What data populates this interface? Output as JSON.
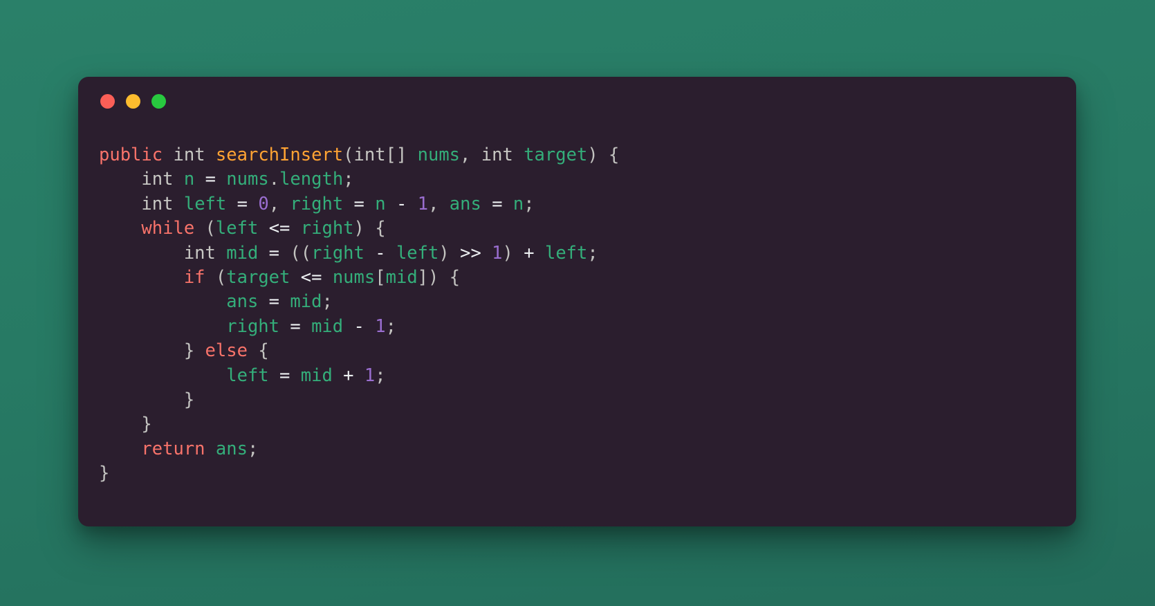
{
  "window": {
    "traffic_lights": [
      {
        "name": "close",
        "color": "#fc5f57"
      },
      {
        "name": "minimize",
        "color": "#fdbc2e"
      },
      {
        "name": "maximize",
        "color": "#28c93f"
      }
    ]
  },
  "theme": {
    "backdrop": "#277a64",
    "card_background": "#2b1e2e",
    "keyword": "#f8736a",
    "type": "#c8c8c4",
    "function": "#ffa333",
    "identifier": "#34ae7a",
    "number": "#9a6ed0",
    "operator": "#eceff1",
    "punctuation": "#c3c3c0"
  },
  "code": {
    "language": "java",
    "full_text": "public int searchInsert(int[] nums, int target) {\n    int n = nums.length;\n    int left = 0, right = n - 1, ans = n;\n    while (left <= right) {\n        int mid = ((right - left) >> 1) + left;\n        if (target <= nums[mid]) {\n            ans = mid;\n            right = mid - 1;\n        } else {\n            left = mid + 1;\n        }\n    }\n    return ans;\n}",
    "lines": [
      {
        "indent": 0,
        "tokens": [
          {
            "t": "public",
            "k": "keyword"
          },
          {
            "t": " ",
            "k": "plain"
          },
          {
            "t": "int",
            "k": "type"
          },
          {
            "t": " ",
            "k": "plain"
          },
          {
            "t": "searchInsert",
            "k": "func"
          },
          {
            "t": "(",
            "k": "punct"
          },
          {
            "t": "int[]",
            "k": "type"
          },
          {
            "t": " ",
            "k": "plain"
          },
          {
            "t": "nums",
            "k": "ident"
          },
          {
            "t": ",",
            "k": "punct"
          },
          {
            "t": " ",
            "k": "plain"
          },
          {
            "t": "int",
            "k": "type"
          },
          {
            "t": " ",
            "k": "plain"
          },
          {
            "t": "target",
            "k": "ident"
          },
          {
            "t": ")",
            "k": "punct"
          },
          {
            "t": " ",
            "k": "plain"
          },
          {
            "t": "{",
            "k": "punct"
          }
        ]
      },
      {
        "indent": 1,
        "tokens": [
          {
            "t": "int",
            "k": "type"
          },
          {
            "t": " ",
            "k": "plain"
          },
          {
            "t": "n",
            "k": "ident"
          },
          {
            "t": " ",
            "k": "plain"
          },
          {
            "t": "=",
            "k": "operator"
          },
          {
            "t": " ",
            "k": "plain"
          },
          {
            "t": "nums",
            "k": "ident"
          },
          {
            "t": ".",
            "k": "punct"
          },
          {
            "t": "length",
            "k": "ident"
          },
          {
            "t": ";",
            "k": "punct"
          }
        ]
      },
      {
        "indent": 1,
        "tokens": [
          {
            "t": "int",
            "k": "type"
          },
          {
            "t": " ",
            "k": "plain"
          },
          {
            "t": "left",
            "k": "ident"
          },
          {
            "t": " ",
            "k": "plain"
          },
          {
            "t": "=",
            "k": "operator"
          },
          {
            "t": " ",
            "k": "plain"
          },
          {
            "t": "0",
            "k": "number"
          },
          {
            "t": ",",
            "k": "punct"
          },
          {
            "t": " ",
            "k": "plain"
          },
          {
            "t": "right",
            "k": "ident"
          },
          {
            "t": " ",
            "k": "plain"
          },
          {
            "t": "=",
            "k": "operator"
          },
          {
            "t": " ",
            "k": "plain"
          },
          {
            "t": "n",
            "k": "ident"
          },
          {
            "t": " ",
            "k": "plain"
          },
          {
            "t": "-",
            "k": "operator"
          },
          {
            "t": " ",
            "k": "plain"
          },
          {
            "t": "1",
            "k": "number"
          },
          {
            "t": ",",
            "k": "punct"
          },
          {
            "t": " ",
            "k": "plain"
          },
          {
            "t": "ans",
            "k": "ident"
          },
          {
            "t": " ",
            "k": "plain"
          },
          {
            "t": "=",
            "k": "operator"
          },
          {
            "t": " ",
            "k": "plain"
          },
          {
            "t": "n",
            "k": "ident"
          },
          {
            "t": ";",
            "k": "punct"
          }
        ]
      },
      {
        "indent": 1,
        "tokens": [
          {
            "t": "while",
            "k": "keyword"
          },
          {
            "t": " ",
            "k": "plain"
          },
          {
            "t": "(",
            "k": "punct"
          },
          {
            "t": "left",
            "k": "ident"
          },
          {
            "t": " ",
            "k": "plain"
          },
          {
            "t": "<=",
            "k": "operator"
          },
          {
            "t": " ",
            "k": "plain"
          },
          {
            "t": "right",
            "k": "ident"
          },
          {
            "t": ")",
            "k": "punct"
          },
          {
            "t": " ",
            "k": "plain"
          },
          {
            "t": "{",
            "k": "punct"
          }
        ]
      },
      {
        "indent": 2,
        "tokens": [
          {
            "t": "int",
            "k": "type"
          },
          {
            "t": " ",
            "k": "plain"
          },
          {
            "t": "mid",
            "k": "ident"
          },
          {
            "t": " ",
            "k": "plain"
          },
          {
            "t": "=",
            "k": "operator"
          },
          {
            "t": " ",
            "k": "plain"
          },
          {
            "t": "((",
            "k": "punct"
          },
          {
            "t": "right",
            "k": "ident"
          },
          {
            "t": " ",
            "k": "plain"
          },
          {
            "t": "-",
            "k": "operator"
          },
          {
            "t": " ",
            "k": "plain"
          },
          {
            "t": "left",
            "k": "ident"
          },
          {
            "t": ")",
            "k": "punct"
          },
          {
            "t": " ",
            "k": "plain"
          },
          {
            "t": ">>",
            "k": "operator"
          },
          {
            "t": " ",
            "k": "plain"
          },
          {
            "t": "1",
            "k": "number"
          },
          {
            "t": ")",
            "k": "punct"
          },
          {
            "t": " ",
            "k": "plain"
          },
          {
            "t": "+",
            "k": "operator"
          },
          {
            "t": " ",
            "k": "plain"
          },
          {
            "t": "left",
            "k": "ident"
          },
          {
            "t": ";",
            "k": "punct"
          }
        ]
      },
      {
        "indent": 2,
        "tokens": [
          {
            "t": "if",
            "k": "keyword"
          },
          {
            "t": " ",
            "k": "plain"
          },
          {
            "t": "(",
            "k": "punct"
          },
          {
            "t": "target",
            "k": "ident"
          },
          {
            "t": " ",
            "k": "plain"
          },
          {
            "t": "<=",
            "k": "operator"
          },
          {
            "t": " ",
            "k": "plain"
          },
          {
            "t": "nums",
            "k": "ident"
          },
          {
            "t": "[",
            "k": "punct"
          },
          {
            "t": "mid",
            "k": "ident"
          },
          {
            "t": "])",
            "k": "punct"
          },
          {
            "t": " ",
            "k": "plain"
          },
          {
            "t": "{",
            "k": "punct"
          }
        ]
      },
      {
        "indent": 3,
        "tokens": [
          {
            "t": "ans",
            "k": "ident"
          },
          {
            "t": " ",
            "k": "plain"
          },
          {
            "t": "=",
            "k": "operator"
          },
          {
            "t": " ",
            "k": "plain"
          },
          {
            "t": "mid",
            "k": "ident"
          },
          {
            "t": ";",
            "k": "punct"
          }
        ]
      },
      {
        "indent": 3,
        "tokens": [
          {
            "t": "right",
            "k": "ident"
          },
          {
            "t": " ",
            "k": "plain"
          },
          {
            "t": "=",
            "k": "operator"
          },
          {
            "t": " ",
            "k": "plain"
          },
          {
            "t": "mid",
            "k": "ident"
          },
          {
            "t": " ",
            "k": "plain"
          },
          {
            "t": "-",
            "k": "operator"
          },
          {
            "t": " ",
            "k": "plain"
          },
          {
            "t": "1",
            "k": "number"
          },
          {
            "t": ";",
            "k": "punct"
          }
        ]
      },
      {
        "indent": 2,
        "tokens": [
          {
            "t": "}",
            "k": "punct"
          },
          {
            "t": " ",
            "k": "plain"
          },
          {
            "t": "else",
            "k": "keyword"
          },
          {
            "t": " ",
            "k": "plain"
          },
          {
            "t": "{",
            "k": "punct"
          }
        ]
      },
      {
        "indent": 3,
        "tokens": [
          {
            "t": "left",
            "k": "ident"
          },
          {
            "t": " ",
            "k": "plain"
          },
          {
            "t": "=",
            "k": "operator"
          },
          {
            "t": " ",
            "k": "plain"
          },
          {
            "t": "mid",
            "k": "ident"
          },
          {
            "t": " ",
            "k": "plain"
          },
          {
            "t": "+",
            "k": "operator"
          },
          {
            "t": " ",
            "k": "plain"
          },
          {
            "t": "1",
            "k": "number"
          },
          {
            "t": ";",
            "k": "punct"
          }
        ]
      },
      {
        "indent": 2,
        "tokens": [
          {
            "t": "}",
            "k": "punct"
          }
        ]
      },
      {
        "indent": 1,
        "tokens": [
          {
            "t": "}",
            "k": "punct"
          }
        ]
      },
      {
        "indent": 1,
        "tokens": [
          {
            "t": "return",
            "k": "keyword"
          },
          {
            "t": " ",
            "k": "plain"
          },
          {
            "t": "ans",
            "k": "ident"
          },
          {
            "t": ";",
            "k": "punct"
          }
        ]
      },
      {
        "indent": 0,
        "tokens": [
          {
            "t": "}",
            "k": "punct"
          }
        ]
      }
    ]
  }
}
